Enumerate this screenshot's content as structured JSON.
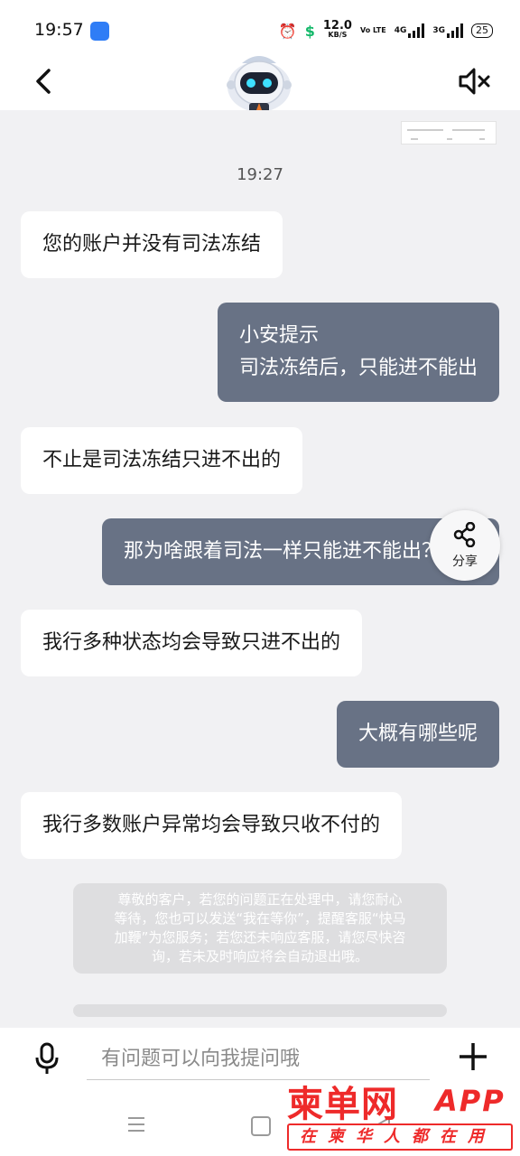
{
  "status_bar": {
    "time": "19:57",
    "net_speed_value": "12.0",
    "net_speed_unit": "KB/S",
    "volte_label": "Vo LTE",
    "sim1_label": "4G",
    "sim2_label": "3G",
    "battery": "25"
  },
  "header": {
    "back_icon": "chevron-left-icon",
    "avatar": "robot-assistant-avatar",
    "mute_icon": "speaker-muted-icon"
  },
  "chat": {
    "timestamp": "19:27",
    "messages": [
      {
        "from": "agent",
        "lines": [
          "您的账户并没有司法冻结"
        ]
      },
      {
        "from": "user",
        "lines": [
          "小安提示",
          "司法冻结后，只能进不能出"
        ]
      },
      {
        "from": "agent",
        "lines": [
          "不止是司法冻结只进不出的"
        ]
      },
      {
        "from": "user",
        "lines": [
          "那为啥跟着司法一样只能进不能出？"
        ]
      },
      {
        "from": "agent",
        "lines": [
          "我行多种状态均会导致只进不出的"
        ]
      },
      {
        "from": "user",
        "lines": [
          "大概有哪些呢"
        ]
      },
      {
        "from": "agent",
        "lines": [
          "我行多数账户异常均会导致只收不付的"
        ]
      }
    ],
    "system_notice_lines": [
      "尊敬的客户，若您的问题正在处理中，请您耐心",
      "等待，您也可以发送“我在等你”，提醒客服“快马",
      "加鞭”为您服务；若您还未响应客服，请您尽快咨",
      "询，若未及时响应将会自动退出哦。"
    ]
  },
  "share": {
    "label": "分享",
    "icon": "share-icon"
  },
  "input": {
    "placeholder": "有问题可以向我提问哦",
    "mic_icon": "microphone-icon",
    "plus_icon": "plus-icon"
  },
  "watermark": {
    "top": "柬单网",
    "app": "APP",
    "bottom": "在柬华人都在用"
  },
  "colors": {
    "outgoing_bubble": "#687285",
    "incoming_bubble": "#ffffff",
    "chat_background": "#f1f1f3",
    "watermark_red": "#ee2a2a"
  }
}
